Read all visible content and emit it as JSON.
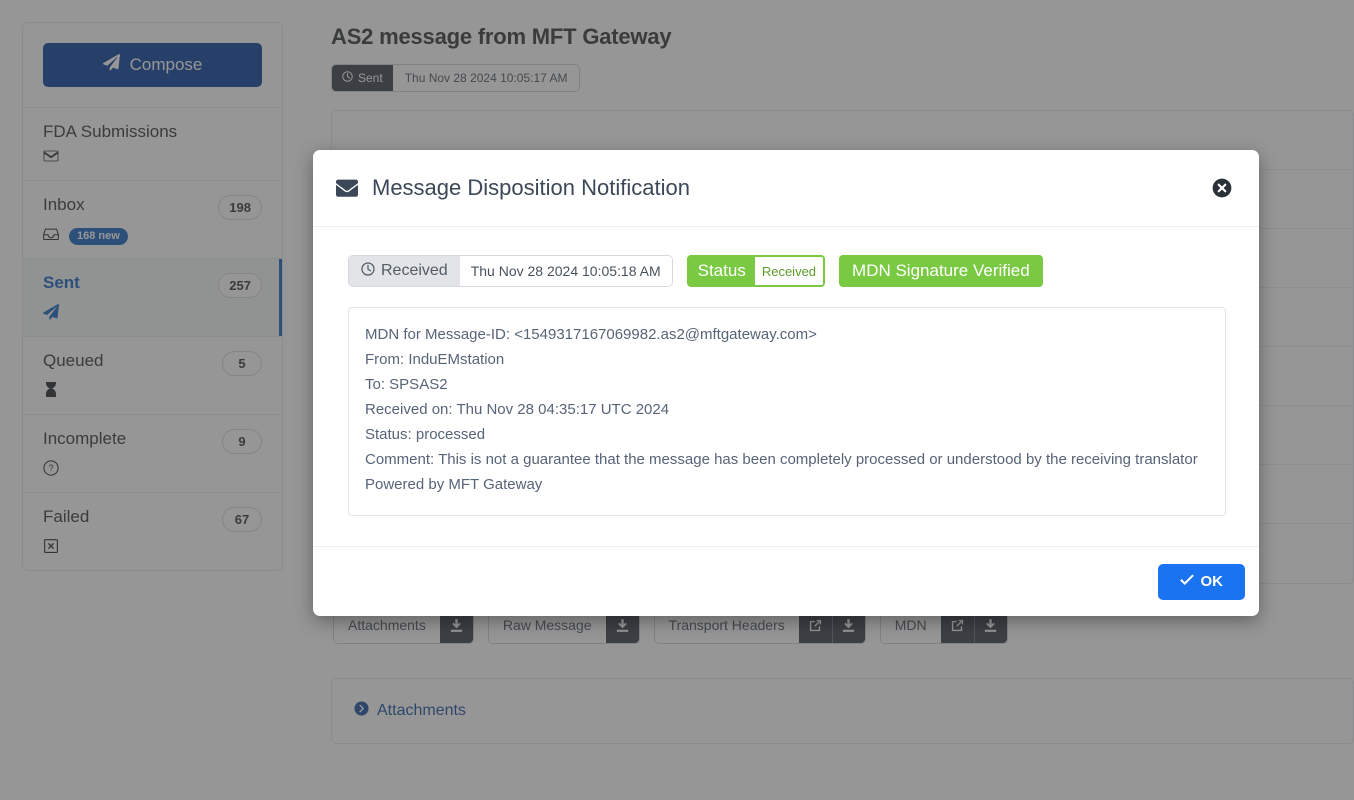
{
  "sidebar": {
    "compose": {
      "label": "Compose",
      "icon": "paper-plane-icon"
    },
    "items": [
      {
        "label": "FDA Submissions",
        "icon": "envelope-icon",
        "count": "",
        "new_badge": ""
      },
      {
        "label": "Inbox",
        "icon": "inbox-icon",
        "count": "198",
        "new_badge": "168 new"
      },
      {
        "label": "Sent",
        "icon": "paper-plane-icon",
        "count": "257",
        "new_badge": "",
        "active": true
      },
      {
        "label": "Queued",
        "icon": "hourglass-icon",
        "count": "5",
        "new_badge": ""
      },
      {
        "label": "Incomplete",
        "icon": "question-circle-icon",
        "count": "9",
        "new_badge": ""
      },
      {
        "label": "Failed",
        "icon": "times-square-icon",
        "count": "67",
        "new_badge": ""
      }
    ]
  },
  "main": {
    "title": "AS2 message from MFT Gateway",
    "sent_label": "Sent",
    "sent_timestamp": "Thu Nov 28 2024 10:05:17 AM",
    "action_buttons": [
      {
        "label": "Attachments",
        "actions": [
          "download-icon"
        ]
      },
      {
        "label": "Raw Message",
        "actions": [
          "download-icon"
        ]
      },
      {
        "label": "Transport Headers",
        "actions": [
          "external-link-icon",
          "download-icon"
        ]
      },
      {
        "label": "MDN",
        "actions": [
          "external-link-icon",
          "download-icon"
        ]
      }
    ],
    "attachments_link": "Attachments"
  },
  "modal": {
    "title": "Message Disposition Notification",
    "title_icon": "envelope-icon",
    "close_icon": "close-circle-icon",
    "received_label": "Received",
    "received_timestamp": "Thu Nov 28 2024 10:05:18 AM",
    "status_key": "Status",
    "status_value": "Received",
    "signature_badge": "MDN Signature Verified",
    "mdn_lines": [
      "MDN for Message-ID: <1549317167069982.as2@mftgateway.com>",
      "From: InduEMstation",
      "To: SPSAS2",
      "Received on: Thu Nov 28 04:35:17 UTC 2024",
      "Status: processed",
      "Comment: This is not a guarantee that the message has been completely processed or understood by the receiving translator",
      "Powered by MFT Gateway"
    ],
    "ok_label": "OK"
  },
  "colors": {
    "primary_blue": "#0b429b",
    "accent_blue": "#1565c0",
    "ok_blue": "#1a73f0",
    "green": "#7ac943",
    "dark_slate": "#38414a",
    "text_slate": "#576478"
  }
}
